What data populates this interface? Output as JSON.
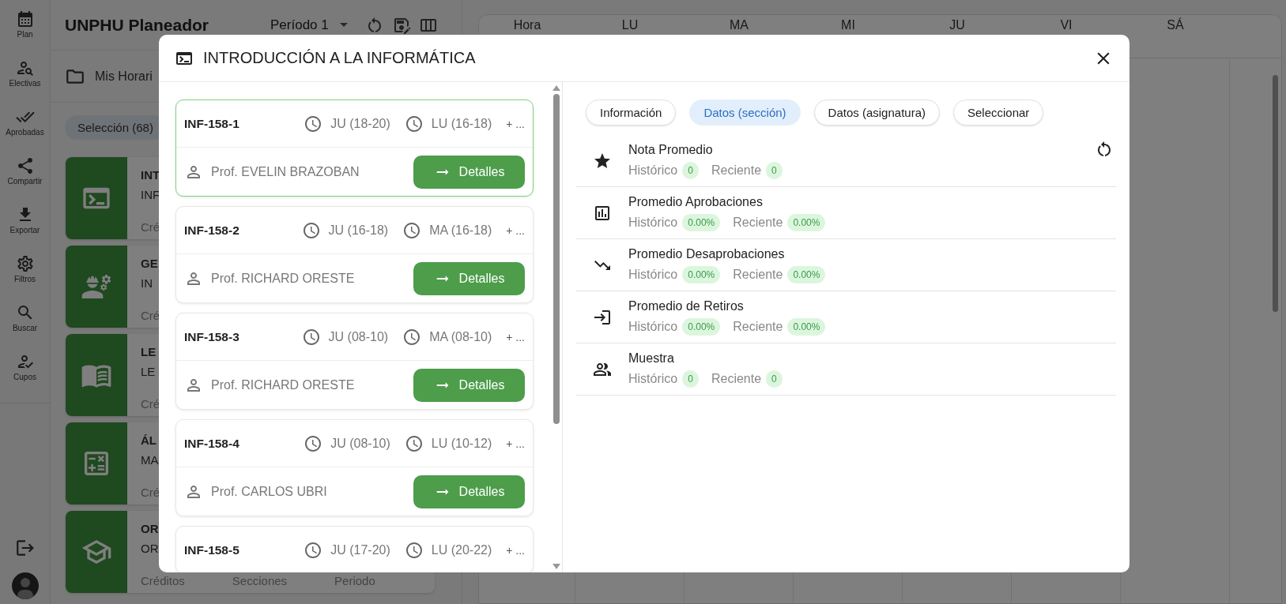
{
  "rail": {
    "items": [
      {
        "label": "Plan"
      },
      {
        "label": "Electivas"
      },
      {
        "label": "Aprobadas"
      },
      {
        "label": "Compartir"
      },
      {
        "label": "Exportar"
      },
      {
        "label": "Filtros"
      },
      {
        "label": "Buscar"
      },
      {
        "label": "Cupos"
      }
    ]
  },
  "header": {
    "title": "UNPHU Planeador",
    "period": "Período 1"
  },
  "folder": {
    "label": "Mis Horari"
  },
  "selection_chip": "Selección (68)",
  "courses": [
    {
      "title": "INT",
      "code": "INF",
      "meta": [
        "Cré"
      ]
    },
    {
      "title": "GE",
      "code": "IN",
      "meta": [
        "Cré"
      ]
    },
    {
      "title": "LE",
      "code": "LE",
      "meta": [
        "Cré"
      ]
    },
    {
      "title": "ÁL",
      "code": "MA",
      "meta": [
        "Cré"
      ]
    },
    {
      "title": "OR",
      "code": "OR",
      "meta": [
        "Créditos",
        "Secciones",
        "Periodo"
      ]
    }
  ],
  "calendar": {
    "columns": [
      "Hora",
      "LU",
      "MA",
      "MI",
      "JU",
      "VI",
      "SÁ"
    ]
  },
  "modal": {
    "title": "INTRODUCCIÓN A LA INFORMÁTICA",
    "sections": [
      {
        "code": "INF-158-1",
        "times": [
          "JU (18-20)",
          "LU (16-18)"
        ],
        "more": "+ ...",
        "professor": "Prof. EVELIN BRAZOBAN",
        "button": "Detalles",
        "selected": true
      },
      {
        "code": "INF-158-2",
        "times": [
          "JU (16-18)",
          "MA (16-18)"
        ],
        "more": "+ ...",
        "professor": "Prof. RICHARD ORESTE",
        "button": "Detalles",
        "selected": false
      },
      {
        "code": "INF-158-3",
        "times": [
          "JU (08-10)",
          "MA (08-10)"
        ],
        "more": "+ ...",
        "professor": "Prof. RICHARD ORESTE",
        "button": "Detalles",
        "selected": false
      },
      {
        "code": "INF-158-4",
        "times": [
          "JU (08-10)",
          "LU (10-12)"
        ],
        "more": "+ ...",
        "professor": "Prof. CARLOS UBRI",
        "button": "Detalles",
        "selected": false
      },
      {
        "code": "INF-158-5",
        "times": [
          "JU (17-20)",
          "LU (20-22)"
        ],
        "more": "+ ...",
        "selected": false
      }
    ],
    "tabs": [
      {
        "label": "Información",
        "selected": false
      },
      {
        "label": "Datos (sección)",
        "selected": true
      },
      {
        "label": "Datos (asignatura)",
        "selected": false
      },
      {
        "label": "Seleccionar",
        "selected": false
      }
    ],
    "stats": [
      {
        "title": "Nota Promedio",
        "values": [
          {
            "label": "Histórico",
            "value": "0"
          },
          {
            "label": "Reciente",
            "value": "0"
          }
        ]
      },
      {
        "title": "Promedio Aprobaciones",
        "values": [
          {
            "label": "Histórico",
            "value": "0.00%"
          },
          {
            "label": "Reciente",
            "value": "0.00%"
          }
        ]
      },
      {
        "title": "Promedio Desaprobaciones",
        "values": [
          {
            "label": "Histórico",
            "value": "0.00%"
          },
          {
            "label": "Reciente",
            "value": "0.00%"
          }
        ]
      },
      {
        "title": "Promedio de Retiros",
        "values": [
          {
            "label": "Histórico",
            "value": "0.00%"
          },
          {
            "label": "Reciente",
            "value": "0.00%"
          }
        ]
      },
      {
        "title": "Muestra",
        "values": [
          {
            "label": "Histórico",
            "value": "0"
          },
          {
            "label": "Reciente",
            "value": "0"
          }
        ]
      }
    ]
  }
}
